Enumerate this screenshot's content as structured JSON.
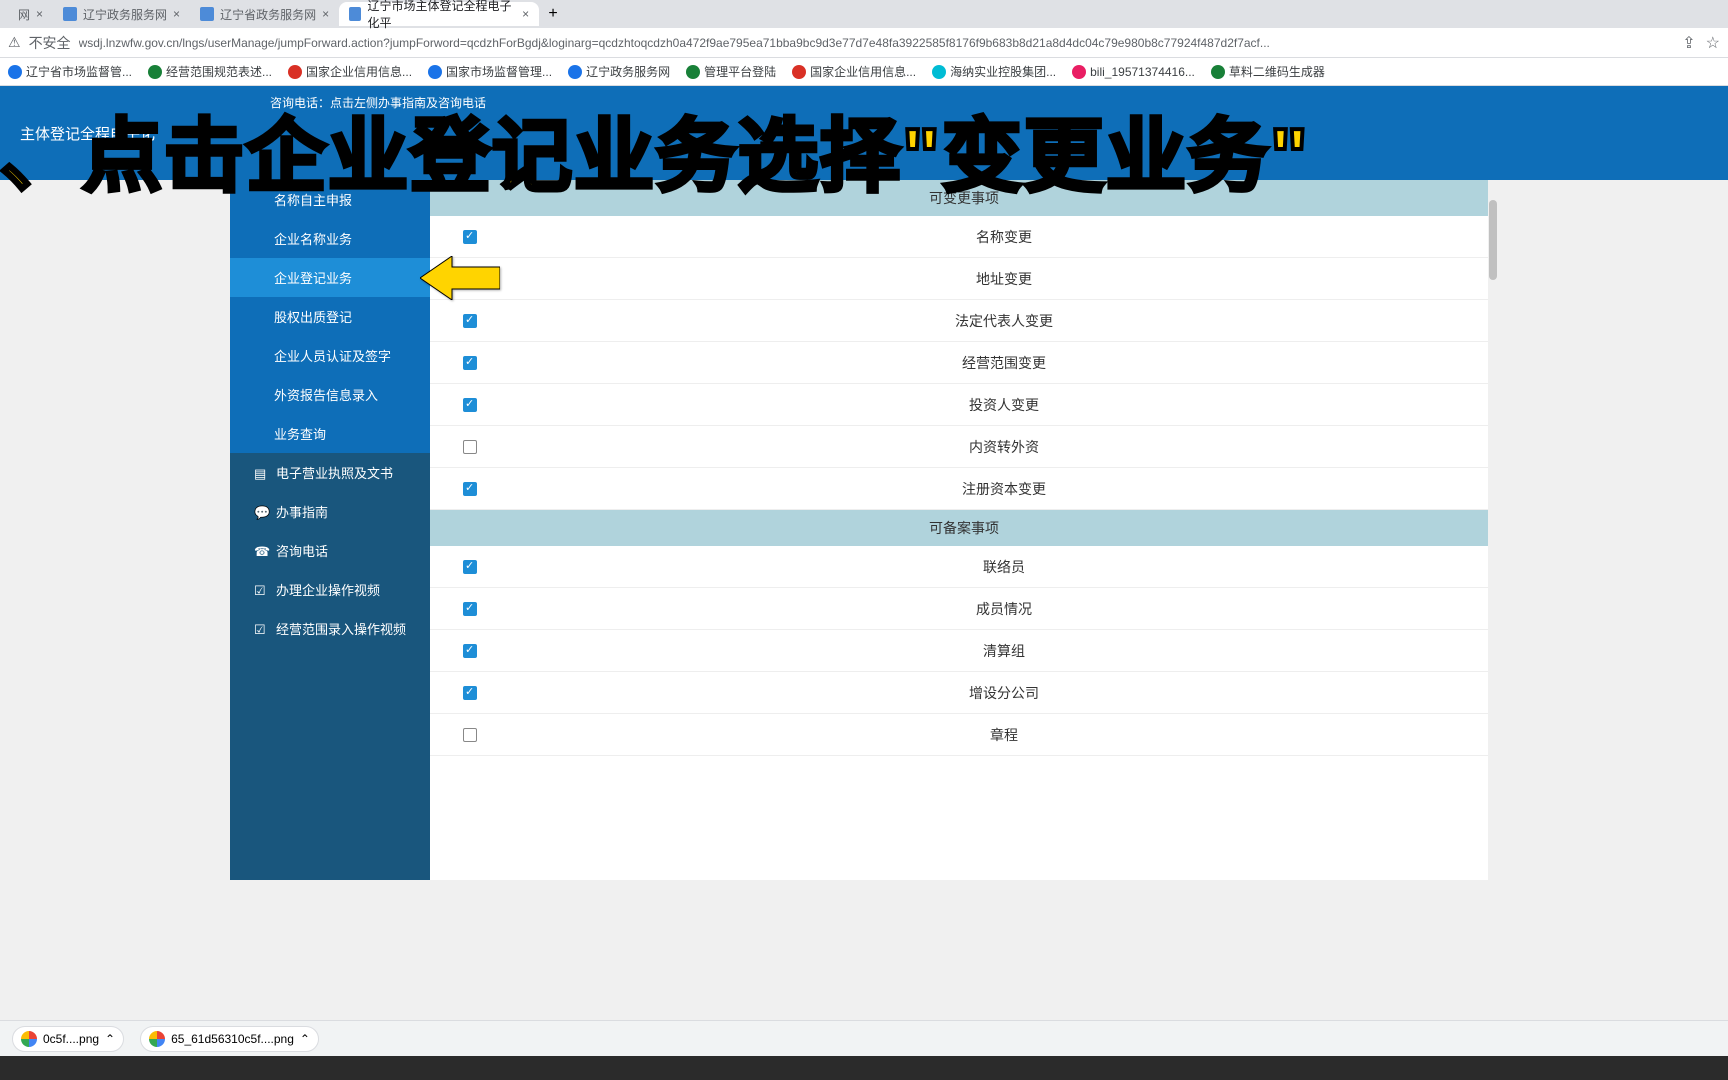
{
  "browser": {
    "tabs": [
      {
        "title": "网",
        "active": false
      },
      {
        "title": "辽宁政务服务网",
        "active": false
      },
      {
        "title": "辽宁省政务服务网",
        "active": false
      },
      {
        "title": "辽宁市场主体登记全程电子化平",
        "active": true
      }
    ],
    "url_prefix": "不安全",
    "url": "wsdj.lnzwfw.gov.cn/lngs/userManage/jumpForward.action?jumpForword=qcdzhForBgdj&loginarg=qcdzhtoqcdzh0a472f9ae795ea71bba9bc9d3e77d7e48fa3922585f8176f9b683b8d21a8d4dc04c79e980b8c77924f487d2f7acf...",
    "bookmarks": [
      {
        "label": "辽宁省市场监督管...",
        "color": "bm-blue"
      },
      {
        "label": "经营范围规范表述...",
        "color": "bm-green"
      },
      {
        "label": "国家企业信用信息...",
        "color": "bm-red"
      },
      {
        "label": "国家市场监督管理...",
        "color": "bm-blue"
      },
      {
        "label": "辽宁政务服务网",
        "color": "bm-blue"
      },
      {
        "label": "管理平台登陆",
        "color": "bm-green"
      },
      {
        "label": "国家企业信用信息...",
        "color": "bm-red"
      },
      {
        "label": "海纳实业控股集团...",
        "color": "bm-cyan"
      },
      {
        "label": "bili_19571374416...",
        "color": "bm-pink"
      },
      {
        "label": "草料二维码生成器",
        "color": "bm-green"
      }
    ]
  },
  "header": {
    "logo_text": "主体登记全程电子化",
    "contact": "咨询电话：点击左侧办事指南及咨询电话"
  },
  "overlay": "、点击企业登记业务选择\"变更业务\"",
  "sidebar": {
    "items": [
      {
        "label": "名称自主申报",
        "type": "sub"
      },
      {
        "label": "企业名称业务",
        "type": "sub"
      },
      {
        "label": "企业登记业务",
        "type": "sub",
        "active": true
      },
      {
        "label": "股权出质登记",
        "type": "sub"
      },
      {
        "label": "企业人员认证及签字",
        "type": "sub"
      },
      {
        "label": "外资报告信息录入",
        "type": "sub"
      },
      {
        "label": "业务查询",
        "type": "sub"
      },
      {
        "label": "电子营业执照及文书",
        "type": "main",
        "icon": "doc"
      },
      {
        "label": "办事指南",
        "type": "main",
        "icon": "chat"
      },
      {
        "label": "咨询电话",
        "type": "main",
        "icon": "phone"
      },
      {
        "label": "办理企业操作视频",
        "type": "main",
        "icon": "check"
      },
      {
        "label": "经营范围录入操作视频",
        "type": "main",
        "icon": "check"
      }
    ]
  },
  "content": {
    "section1_title": "可变更事项",
    "section2_title": "可备案事项",
    "change_items": [
      {
        "label": "名称变更",
        "checked": true
      },
      {
        "label": "地址变更",
        "checked": true
      },
      {
        "label": "法定代表人变更",
        "checked": true
      },
      {
        "label": "经营范围变更",
        "checked": true
      },
      {
        "label": "投资人变更",
        "checked": true
      },
      {
        "label": "内资转外资",
        "checked": false
      },
      {
        "label": "注册资本变更",
        "checked": true
      }
    ],
    "record_items": [
      {
        "label": "联络员",
        "checked": true
      },
      {
        "label": "成员情况",
        "checked": true
      },
      {
        "label": "清算组",
        "checked": true
      },
      {
        "label": "增设分公司",
        "checked": true
      },
      {
        "label": "章程",
        "checked": false
      }
    ]
  },
  "downloads": [
    {
      "filename": "0c5f....png"
    },
    {
      "filename": "65_61d56310c5f....png"
    }
  ]
}
